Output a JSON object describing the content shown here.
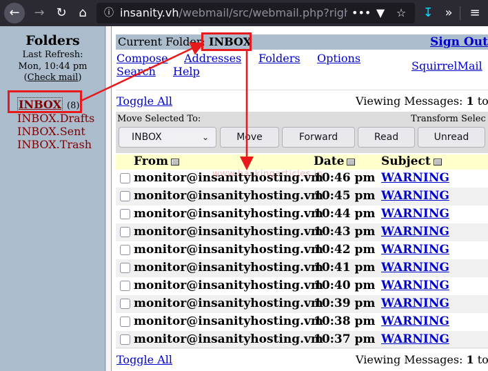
{
  "browser": {
    "url_host": "insanity.vh",
    "url_path": "/webmail/src/webmail.php?right_fr"
  },
  "left_frame": {
    "title": "Folders",
    "refresh_line1": "Last  Refresh:",
    "refresh_line2": "Mon,  10:44  pm",
    "check_mail": "Check mail",
    "check_open": "(",
    "check_close": ")",
    "folders": [
      {
        "name": "INBOX",
        "count": "(8)"
      },
      {
        "name": "INBOX.Drafts"
      },
      {
        "name": "INBOX.Sent"
      },
      {
        "name": "INBOX.Trash"
      }
    ]
  },
  "header": {
    "current_folder_label": "Current Folder: ",
    "current_folder": "INBOX",
    "sign_out": "Sign Out"
  },
  "menu": {
    "compose": "Compose",
    "addresses": "Addresses",
    "folders": "Folders",
    "options": "Options",
    "search": "Search",
    "help": "Help",
    "squirrelmail": "SquirrelMail"
  },
  "list_controls": {
    "toggle_all": "Toggle All",
    "viewing_prefix": "Viewing Messages: ",
    "viewing_start": "1",
    "viewing_suffix": " to",
    "move_selected_to": "Move Selected To:",
    "transform_selected": "Transform Selec",
    "folder_select_value": "INBOX",
    "move": "Move",
    "forward": "Forward",
    "read": "Read",
    "unread": "Unread"
  },
  "table": {
    "columns": [
      "From",
      "Date",
      "Subject"
    ],
    "rows": [
      {
        "from": "monitor@insanityhosting.vm",
        "date": "10:46 pm",
        "subject": "WARNING"
      },
      {
        "from": "monitor@insanityhosting.vm",
        "date": "10:45 pm",
        "subject": "WARNING"
      },
      {
        "from": "monitor@insanityhosting.vm",
        "date": "10:44 pm",
        "subject": "WARNING"
      },
      {
        "from": "monitor@insanityhosting.vm",
        "date": "10:43 pm",
        "subject": "WARNING"
      },
      {
        "from": "monitor@insanityhosting.vm",
        "date": "10:42 pm",
        "subject": "WARNING"
      },
      {
        "from": "monitor@insanityhosting.vm",
        "date": "10:41 pm",
        "subject": "WARNING"
      },
      {
        "from": "monitor@insanityhosting.vm",
        "date": "10:40 pm",
        "subject": "WARNING"
      },
      {
        "from": "monitor@insanityhosting.vm",
        "date": "10:39 pm",
        "subject": "WARNING"
      },
      {
        "from": "monitor@insanityhosting.vm",
        "date": "10:38 pm",
        "subject": "WARNING"
      },
      {
        "from": "monitor@insanityhosting.vm",
        "date": "10:37 pm",
        "subject": "WARNING"
      }
    ]
  },
  "footer": {
    "toggle_all": "Toggle All",
    "viewing_prefix": "Viewing Messages: ",
    "viewing_start": "1",
    "viewing_suffix": " to"
  },
  "watermark": "www.hackingarticles.in",
  "colors": {
    "annotation_red": "#e8191b",
    "frame_blue": "#abbccd",
    "folder_text": "#800000",
    "link_blue": "#0000cc",
    "header_row": "#ffffcc"
  },
  "icons": [
    "back-arrow-icon",
    "forward-arrow-icon",
    "reload-icon",
    "home-icon",
    "info-icon",
    "more-dots-icon",
    "pocket-icon",
    "bookmark-star-icon",
    "download-icon",
    "overflow-chevrons-icon",
    "hamburger-menu-icon",
    "chevron-down-icon"
  ]
}
